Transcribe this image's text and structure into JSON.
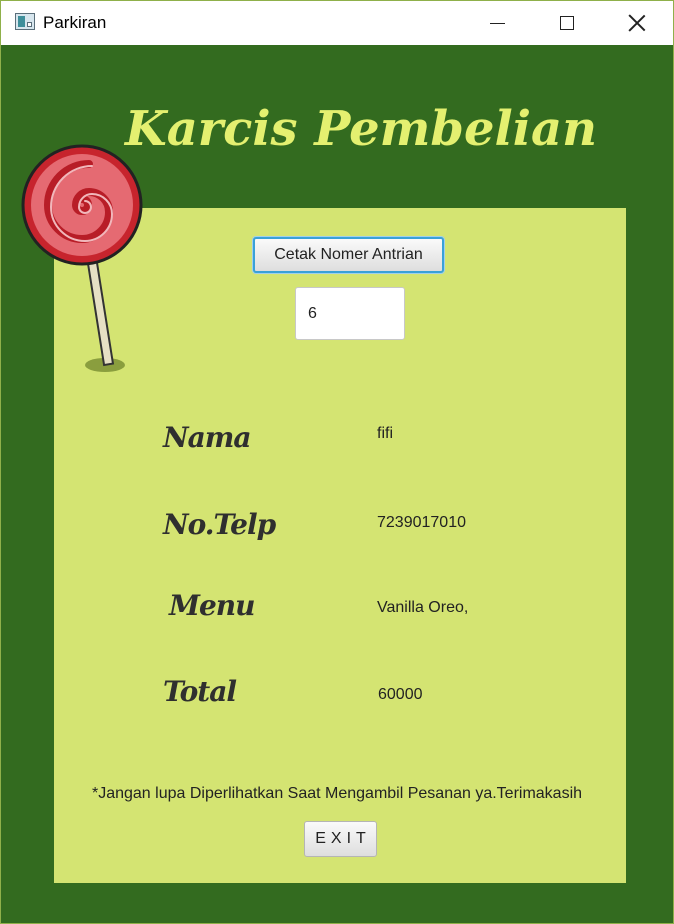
{
  "window": {
    "title": "Parkiran",
    "icon": "app-window-icon"
  },
  "title_controls": {
    "minimize_icon": "minimize-icon",
    "maximize_icon": "maximize-icon",
    "close_icon": "close-icon"
  },
  "colors": {
    "frame_bg": "#336b1f",
    "panel_bg": "#d4e472",
    "heading": "#e4f070",
    "button_focus": "#3aa1d8"
  },
  "heading": "Karcis Pembelian",
  "decoration": {
    "icon": "lollipop-icon"
  },
  "queue": {
    "button_label": "Cetak Nomer Antrian",
    "number_value": "6"
  },
  "fields": [
    {
      "label": "Nama",
      "value": "fifi"
    },
    {
      "label": "No.Telp",
      "value": "7239017010"
    },
    {
      "label": "Menu",
      "value": "Vanilla Oreo,"
    },
    {
      "label": "Total",
      "value": "60000"
    }
  ],
  "note": "*Jangan lupa Diperlihatkan Saat Mengambil Pesanan ya.Terimakasih",
  "exit_label": "EXIT"
}
